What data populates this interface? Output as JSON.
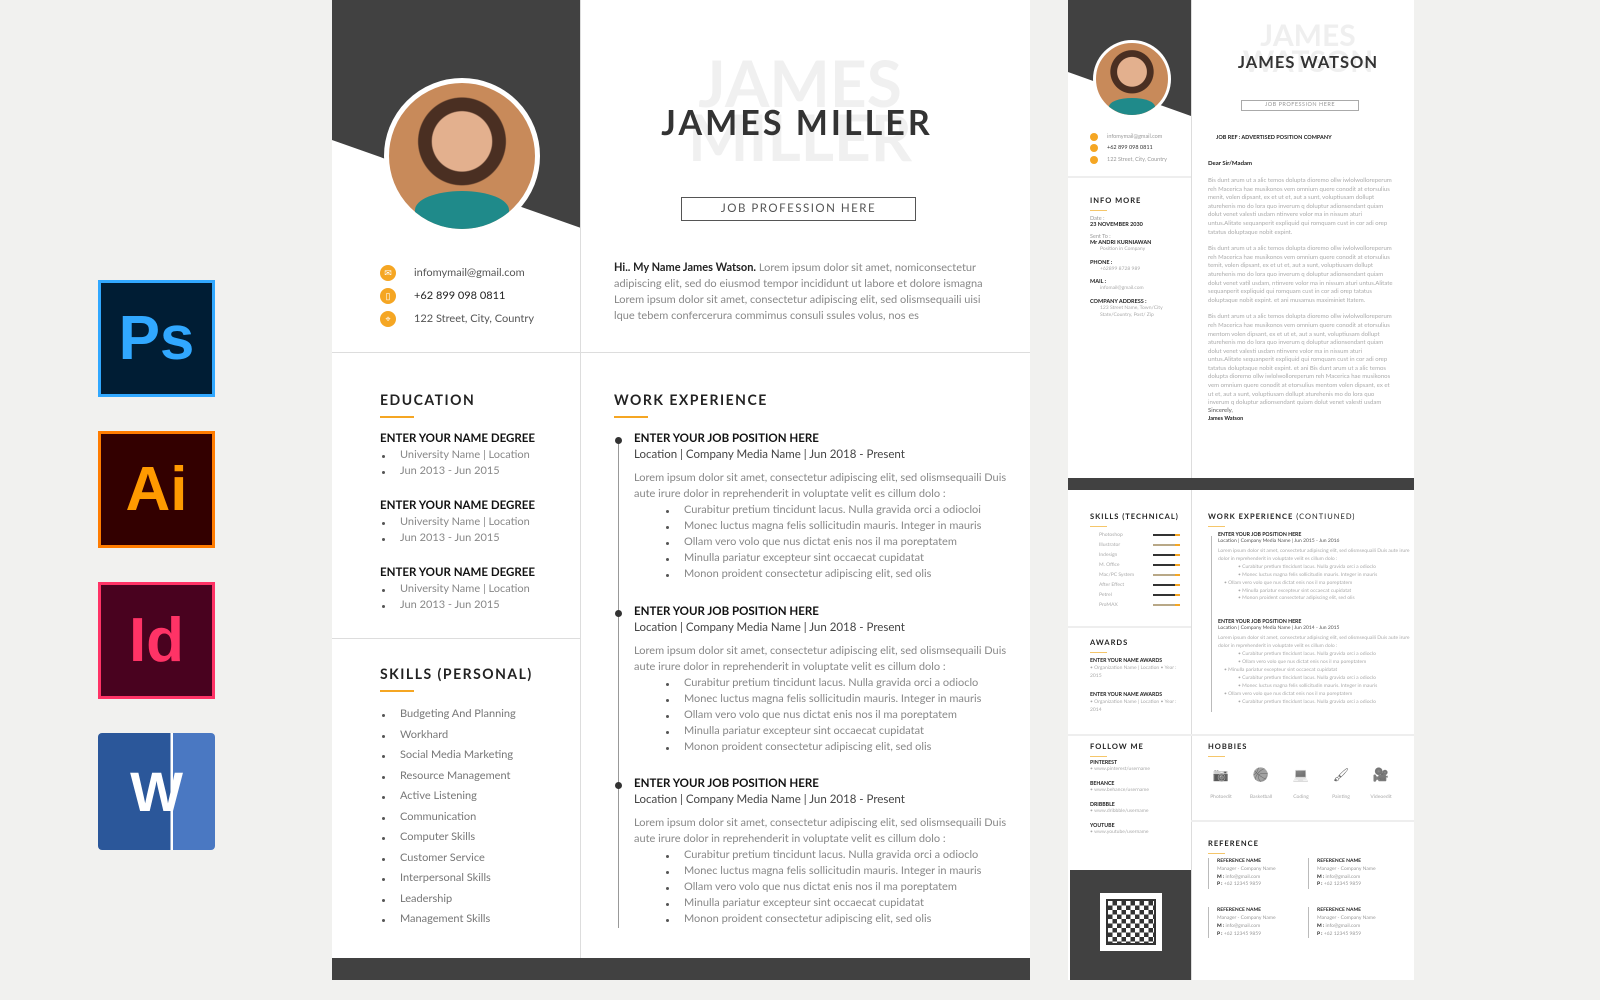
{
  "software_icons": [
    {
      "label": "Ps",
      "bg": "#001d34",
      "fg": "#31a8ff",
      "border": "#31a8ff"
    },
    {
      "label": "Ai",
      "bg": "#330000",
      "fg": "#ff9a00",
      "border": "#ff7c00"
    },
    {
      "label": "Id",
      "bg": "#49021f",
      "fg": "#ff3366",
      "border": "#ff3366"
    },
    {
      "label": "W",
      "bg": "#2b579a",
      "fg": "#ffffff",
      "border": "#2b579a"
    }
  ],
  "colors": {
    "accent": "#f5a623",
    "dark": "#414141"
  },
  "resume": {
    "name": "JAMES MILLER",
    "name_watermark_1": "JAMES",
    "name_watermark_2": "MILLER",
    "profession": "JOB PROFESSION HERE",
    "contacts": [
      {
        "icon": "mail-icon",
        "text": "infomymail@gmail.com"
      },
      {
        "icon": "phone-icon",
        "text": "+62 899 098 0811"
      },
      {
        "icon": "location-icon",
        "text": "122 Street, City, Country"
      }
    ],
    "intro_bold": "Hi.. My Name James Watson.",
    "intro": " Lorem ipsum dolor sit amet, nomiconsectetur adipiscing elit, sed do eiusmod tempor incididunt ut labore et dolore ismagna Lorem ipsum dolor sit amet, consectetur adipiscing elit, sed olismsequaili uisi lque tebem confercerura commimus consuli ssules volus, nos es",
    "education_title": "EDUCATION",
    "education": [
      {
        "degree": "ENTER YOUR NAME DEGREE",
        "school": "University Name | Location",
        "years": "Jun 2013 - Jun 2015"
      },
      {
        "degree": "ENTER YOUR NAME DEGREE",
        "school": "University Name | Location",
        "years": "Jun 2013 - Jun 2015"
      },
      {
        "degree": "ENTER YOUR NAME DEGREE",
        "school": "University Name | Location",
        "years": "Jun 2013 - Jun 2015"
      }
    ],
    "skills_title": "SKILLS (PERSONAL)",
    "skills": [
      "Budgeting And Planning",
      "Workhard",
      "Social Media Marketing",
      "Resource Management",
      "Active Listening",
      "Communication",
      "Computer Skills",
      "Customer Service",
      "Interpersonal Skills",
      "Leadership",
      "Management Skills"
    ],
    "work_title": "WORK EXPERIENCE",
    "jobs": [
      {
        "title": "ENTER YOUR JOB POSITION HERE",
        "meta": "Location | Company Media Name  |  Jun 2018 - Present",
        "desc": "Lorem ipsum dolor sit amet, consectetur adipiscing elit, sed olismsequaili Duis aute irure dolor in reprehenderit in voluptate velit es cillum dolo :",
        "bullets": [
          "Curabitur pretium tincidunt lacus. Nulla gravida orci a odiocloi",
          "Monec luctus magna felis sollicitudin mauris. Integer in mauris",
          "Ollam vero volo que nus dictat enis nos il ma poreptatem",
          "Minulla pariatur excepteur sint occaecat cupidatat",
          "Monon proident consectetur adipiscing elit, sed olis"
        ]
      },
      {
        "title": "ENTER YOUR JOB POSITION HERE",
        "meta": "Location | Company Media Name  |  Jun 2018 - Present",
        "desc": "Lorem ipsum dolor sit amet, consectetur adipiscing elit, sed olismsequaili Duis aute irure dolor in reprehenderit in voluptate velit es cillum dolo :",
        "bullets": [
          "Curabitur pretium tincidunt lacus. Nulla gravida orci a odioclo",
          "Monec luctus magna felis sollicitudin mauris. Integer in mauris",
          "Ollam vero volo que nus dictat enis nos il ma poreptatem",
          "Minulla pariatur excepteur sint occaecat cupidatat",
          "Monon proident consectetur adipiscing elit, sed olis"
        ]
      },
      {
        "title": "ENTER YOUR JOB POSITION HERE",
        "meta": "Location | Company Media Name  |  Jun 2018 - Present",
        "desc": "Lorem ipsum dolor sit amet, consectetur adipiscing elit, sed olismsequaili Duis aute irure dolor in reprehenderit in voluptate velit es cillum dolo :",
        "bullets": [
          "Curabitur pretium tincidunt lacus. Nulla gravida orci a odioclo",
          "Monec luctus magna felis sollicitudin mauris. Integer in mauris",
          "Ollam vero volo que nus dictat enis nos il ma poreptatem",
          "Minulla pariatur excepteur sint occaecat cupidatat",
          "Monon proident consectetur adipiscing elit, sed olis"
        ]
      }
    ]
  },
  "cover": {
    "name": "JAMES WATSON",
    "wm1": "JAMES",
    "wm2": "WATSON",
    "profession": "JOB PROFESSION HERE",
    "contacts": [
      "infomymail@gmail.com",
      "+62 899 098 0811",
      "122 Street, City, Country"
    ],
    "info_title": "INFO MORE",
    "info": [
      {
        "label": "Date :",
        "value": "23 NOVEMBER 2030"
      },
      {
        "label": "Sent To :",
        "value": "Mr ANDRI KURNIAWAN",
        "bullet": "Position in Company"
      },
      {
        "label": "",
        "value": "PHONE :",
        "bullet": "+62899 8728 989"
      },
      {
        "label": "",
        "value": "MAIL :",
        "bullet": "infomail@gmail.com"
      },
      {
        "label": "",
        "value": "COMPANY ADDRESS :",
        "bullet": "123 Street Name, Town/City State/Country, Post/ Zip"
      }
    ],
    "job_ref": "JOB REF : ADVERTISED POSITION COMPANY",
    "greeting": "Dear Sir/Madam",
    "paragraphs": [
      "Bis dunt arum ut a alic temos dolupta dioremo ollw iwlolwolloreperum reh Macerica hae musikonos vem omnium quere conodit at etorsulius menit, volen dipsant, ex et ut et, aut a sunt, voluptiusam dollupt aturehenis mo do lora quo inverum q doluptur adionsendant quiam dolut venet valesti usdam ntinvere volor ma in nissum aturi untus.Alitate sequanperit expliquid qui romquam cust in cor adi orep tatatus doluptaque nobit expint.",
      "Bis dunt arum ut a alic temos dolupta dioremo ollw iwlolwolloreperum reh Macerica hae musikonos vem omnium quere conodit at etorsulius temit, volen dipsant, ex et ut et, aut a sunt, voluptiusam dollupt aturehenis mo do lora quo inverum q doluptur adionsendant quiam dolut venet vatil usdam, ntinvere volor ma in nissum aturi untus.Alitate sequanperit expliquid qui romquam cust in cor adi orep tatatus doluptaque nobit expint. et ani musamus maximiniet Itatem.",
      "Bis dunt arum ut a alic temos dolupta dioremo ollw iwlolwolloreperum reh Macerica hae musikonos vem omnium quere conodit at etorsulius mentom volen dipsant, ex et ut et, aut a sunt, voluptiusam dollupt aturehenis mo do lora quo inverum q doluptur adionsendant quiam dolut venet valesti usdam ntinvere volor ma in nissum aturi untus.Alitate sequanperit expliquid qui romquam cust in cor adi orep tatatus doluptaque nobit expint. et ani Bis dunt arum ut a alic temos dolupta dioremo ollw iwlolwolloreperum reh Macerica hae musikonos vem omnium quere conodit at etorsulius mentom volen dipsant, ex et ut et, aut a sunt, voluptiusam dollupt aturehenis mo do lora quo inverum q doluptur adionsendant quiam dolut venet valesti usdam"
    ],
    "sincerely": "Sincerely,",
    "signature": "James Watson"
  },
  "page2": {
    "skills_title": "SKILLS (TECHNICAL)",
    "skills": [
      {
        "name": "Photoshop",
        "level": 0.8
      },
      {
        "name": "Illustrator",
        "level": 0.8
      },
      {
        "name": "Indesign",
        "level": 0.8
      },
      {
        "name": "M. Office",
        "level": 0.8
      },
      {
        "name": "Mac/PC System",
        "level": 0.8
      },
      {
        "name": "After Effect",
        "level": 0.8
      },
      {
        "name": "Petrel",
        "level": 0.8
      },
      {
        "name": "ProMAX",
        "level": 0.8
      }
    ],
    "awards_title": "AWARDS",
    "awards": [
      {
        "name": "ENTER YOUR NAME AWARDS",
        "detail": "• Organization Name | Location • Year : 2015"
      },
      {
        "name": "ENTER YOUR NAME AWARDS",
        "detail": "• Organization Name | Location • Year : 2014"
      }
    ],
    "follow_title": "FOLLOW ME",
    "follow": [
      {
        "name": "PINTEREST",
        "url": "• www.pinterest/username"
      },
      {
        "name": "BEHANCE",
        "url": "• www.behance/username"
      },
      {
        "name": "DRIBBBLE",
        "url": "• www.dribbble/username"
      },
      {
        "name": "YOUTUBE",
        "url": "• www.youtube/username"
      }
    ],
    "work_title": "WORK EXPERIENCE",
    "work_title_suffix": " (CONTIUNED)",
    "jobs": [
      {
        "title": "ENTER YOUR JOB POSITION HERE",
        "meta": "Location | Company Media Name | Jun 2015 - Jun 2016",
        "desc": "Lorem ipsum dolor sit amet, consectetur adipiscing elit, sed olismsequaili Duis aute irure dolor in reprehenderit in voluptate velit es cillum dolo :",
        "bullets": [
          "• Curabitur pretium tincidunt lacus. Nulla gravida orci a odioclo",
          "• Monec luctus magna felis sollicitudin mauris. Integer in mauris",
          "• Ollam vero volo que nus dictat enis nos il ma poreptatem",
          "• Minulla pariatur excepteur sint occaecat cupidatat",
          "• Monon proident consectetur adipiscing elit, sed olis"
        ]
      },
      {
        "title": "ENTER YOUR JOB POSITION HERE",
        "meta": "Location | Company Media Name | Jun 2014 - Jun 2015",
        "desc": "Lorem ipsum dolor sit amet, consectetur adipiscing elit, sed olismsequaili Duis aute irure dolor in reprehenderit in voluptate velit es cillum dolo :",
        "bullets": [
          "• Curabitur pretium tincidunt lacus. Nulla gravida orci a odioclo",
          "• Ollam vero volo que nus dictat enis nos il ma poreptatem",
          "• Minulla pariatur excepteur sint occaecat cupidatat",
          "• Curabitur pretium tincidunt lacus. Nulla gravida orci a odioclo",
          "• Monec luctus magna felis sollicitudin mauris. Integer in mauris",
          "• Ollam vero volo que nus dictat enis nos il ma poreptatem",
          "• Curabitur pretium tincidunt lacus. Nulla gravida orci a odioclo"
        ]
      }
    ],
    "hobbies_title": "HOBBIES",
    "hobbies": [
      {
        "icon": "camera-icon",
        "glyph": "📷",
        "label": "Photoedit"
      },
      {
        "icon": "basketball-icon",
        "glyph": "🏀",
        "label": "Basketball"
      },
      {
        "icon": "laptop-icon",
        "glyph": "💻",
        "label": "Coding"
      },
      {
        "icon": "paint-roller-icon",
        "glyph": "🖌",
        "label": "Painting"
      },
      {
        "icon": "video-camera-icon",
        "glyph": "🎥",
        "label": "Videoedit"
      }
    ],
    "reference_title": "REFERENCE",
    "references": [
      {
        "name": "REFERENCE NAME",
        "role": "Manager - Company Name",
        "m_label": "M :",
        "mail": " info@gmail.com",
        "p_label": "P :",
        "phone": " +62 12345 9859"
      },
      {
        "name": "REFERENCE NAME",
        "role": "Manager - Company Name",
        "m_label": "M :",
        "mail": " info@gmail.com",
        "p_label": "P :",
        "phone": " +62 12345 9859"
      },
      {
        "name": "REFERENCE NAME",
        "role": "Manager - Company Name",
        "m_label": "M :",
        "mail": " info@gmail.com",
        "p_label": "P :",
        "phone": " +62 12345 9859"
      },
      {
        "name": "REFERENCE NAME",
        "role": "Manager - Company Name",
        "m_label": "M :",
        "mail": " info@gmail.com",
        "p_label": "P :",
        "phone": " +62 12345 9859"
      }
    ]
  }
}
